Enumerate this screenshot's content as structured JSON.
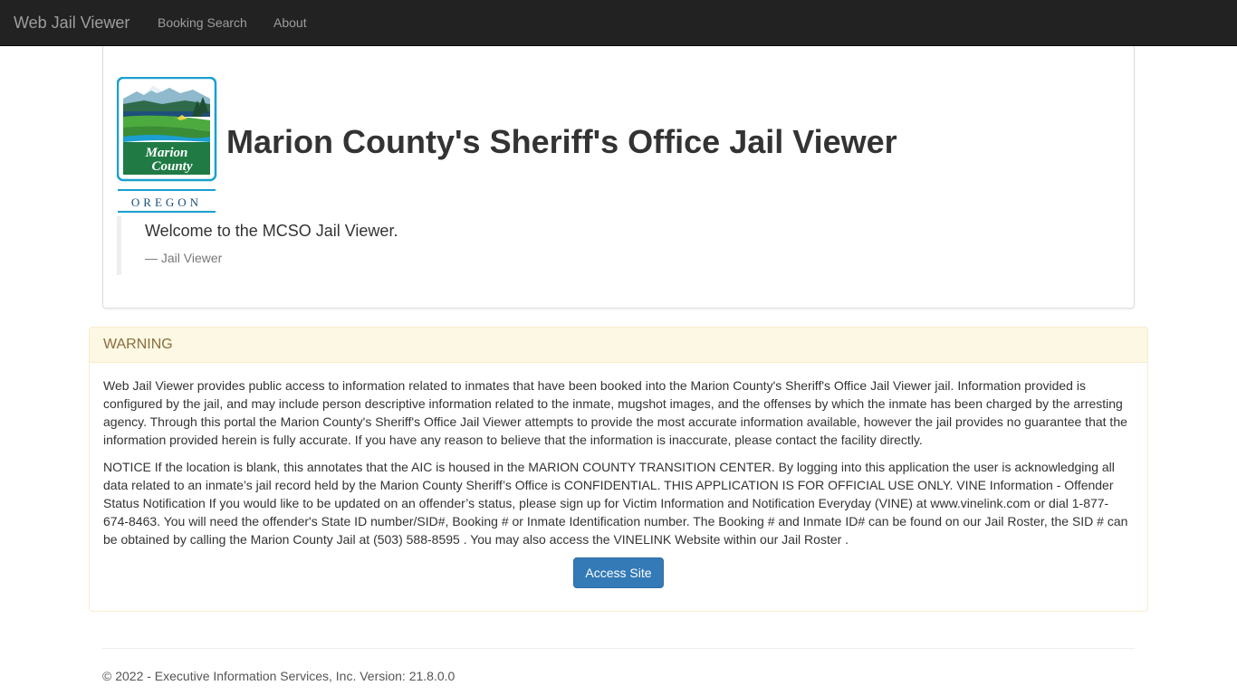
{
  "navbar": {
    "brand": "Web Jail Viewer",
    "links": [
      "Booking Search",
      "About"
    ]
  },
  "header": {
    "logo": {
      "text_line1": "Marion",
      "text_line2": "County",
      "state": "OREGON"
    },
    "title": "Marion County's Sheriff's Office Jail Viewer",
    "quote": "Welcome to the MCSO Jail Viewer.",
    "quote_footer": "— Jail Viewer"
  },
  "warning": {
    "heading": "WARNING",
    "paragraph1": "Web Jail Viewer provides public access to information related to inmates that have been booked into the Marion County's Sheriff's Office Jail Viewer jail. Information provided is configured by the jail, and may include person descriptive information related to the inmate, mugshot images, and the offenses by which the inmate has been charged by the arresting agency. Through this portal the Marion County's Sheriff's Office Jail Viewer attempts to provide the most accurate information available, however the jail provides no guarantee that the information provided herein is fully accurate. If you have any reason to believe that the information is inaccurate, please contact the facility directly.",
    "paragraph2": "NOTICE If the location is blank, this annotates that the AIC is housed in the MARION COUNTY TRANSITION CENTER. By logging into this application the user is acknowledging all data related to an inmate’s jail record held by the Marion County Sheriff’s Office is CONFIDENTIAL. THIS APPLICATION IS FOR OFFICIAL USE ONLY. VINE Information - Offender Status Notification If you would like to be updated on an offender’s status, please sign up for Victim Information and Notification Everyday (VINE) at www.vinelink.com or dial 1-877-674-8463. You will need the offender's State ID number/SID#, Booking # or Inmate Identification number. The Booking # and Inmate ID# can be found on our Jail Roster, the SID # can be obtained by calling the Marion County Jail at (503) 588-8595 . You may also access the VINELINK Website within our Jail Roster .",
    "button_label": "Access Site"
  },
  "footer": {
    "text": "© 2022 - Executive Information Services, Inc. Version: 21.8.0.0"
  },
  "colors": {
    "navbar_bg": "#222222",
    "nav_text": "#9d9d9d",
    "warning_bg": "#fcf8e3",
    "warning_border": "#faebcc",
    "warning_text": "#8a6d3b",
    "primary_button": "#337ab7"
  }
}
